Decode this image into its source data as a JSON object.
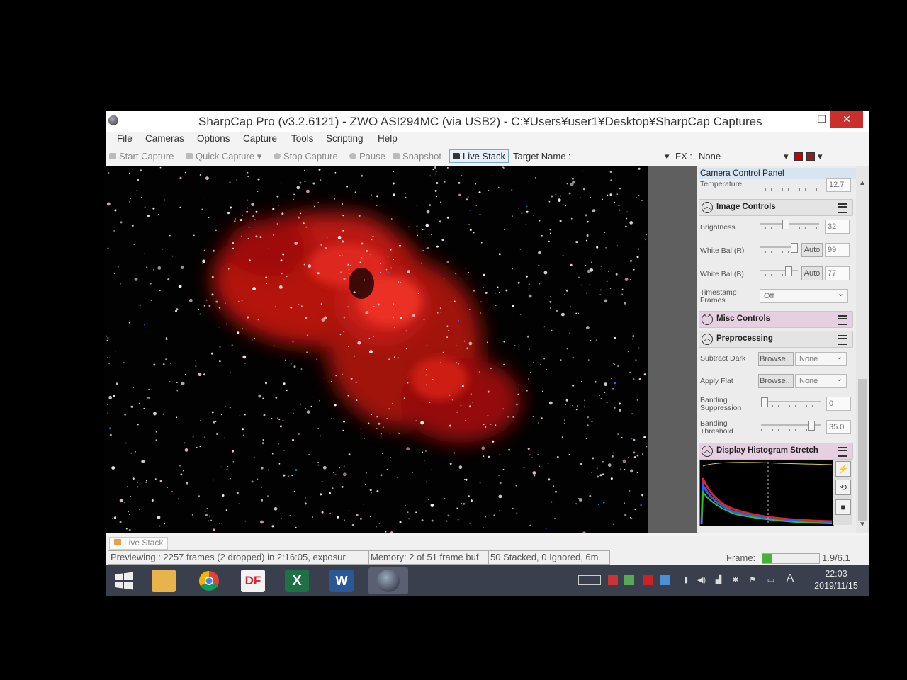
{
  "window": {
    "title": "SharpCap Pro (v3.2.6121) - ZWO ASI294MC (via USB2) - C:¥Users¥user1¥Desktop¥SharpCap Captures",
    "minimize": "—",
    "restore": "❒",
    "close": "✕"
  },
  "menu": [
    "File",
    "Cameras",
    "Options",
    "Capture",
    "Tools",
    "Scripting",
    "Help"
  ],
  "toolbar": {
    "start_capture": "Start Capture",
    "quick_capture": "Quick Capture",
    "stop_capture": "Stop Capture",
    "pause": "Pause",
    "snapshot": "Snapshot",
    "live_stack": "Live Stack",
    "target_name_label": "Target Name :",
    "fx_label": "FX :",
    "fx_value": "None"
  },
  "panel": {
    "title": "Camera Control Panel",
    "temperature_label": "Temperature",
    "temperature_value": "12.7",
    "image_controls": {
      "header": "Image Controls",
      "brightness_label": "Brightness",
      "brightness_value": "32",
      "wb_r_label": "White Bal (R)",
      "wb_r_value": "99",
      "wb_b_label": "White Bal (B)",
      "wb_b_value": "77",
      "auto_label": "Auto",
      "timestamp_label_1": "Timestamp",
      "timestamp_label_2": "Frames",
      "timestamp_value": "Off"
    },
    "misc_controls": {
      "header": "Misc Controls"
    },
    "preprocessing": {
      "header": "Preprocessing",
      "subtract_dark_label": "Subtract Dark",
      "apply_flat_label": "Apply Flat",
      "browse_label": "Browse...",
      "none_label": "None",
      "banding_suppression_1": "Banding",
      "banding_suppression_2": "Suppression",
      "banding_suppression_value": "0",
      "banding_threshold_1": "Banding",
      "banding_threshold_2": "Threshold",
      "banding_threshold_value": "35.0"
    },
    "histogram": {
      "header": "Display Histogram Stretch"
    }
  },
  "tabs": {
    "live_stack": "Live Stack"
  },
  "status": {
    "previewing": "Previewing : 2257 frames (2 dropped) in 2:16:05, exposur",
    "memory": "Memory: 2 of 51 frame buf",
    "stacked": "50 Stacked, 0 Ignored, 6m",
    "frame_label": "Frame:",
    "fps": "1.9/6.1",
    "frame_fill": 0.18
  },
  "taskbar": {
    "pdf_app": "DF",
    "excel": "X",
    "word": "W",
    "ime": "A",
    "time": "22:03",
    "date": "2019/11/15"
  },
  "colors": {
    "nebula": "#e0201a",
    "close": "#c9302c",
    "taskbar": "#3a3f4e",
    "accent_pink": "#e6cfe0"
  }
}
